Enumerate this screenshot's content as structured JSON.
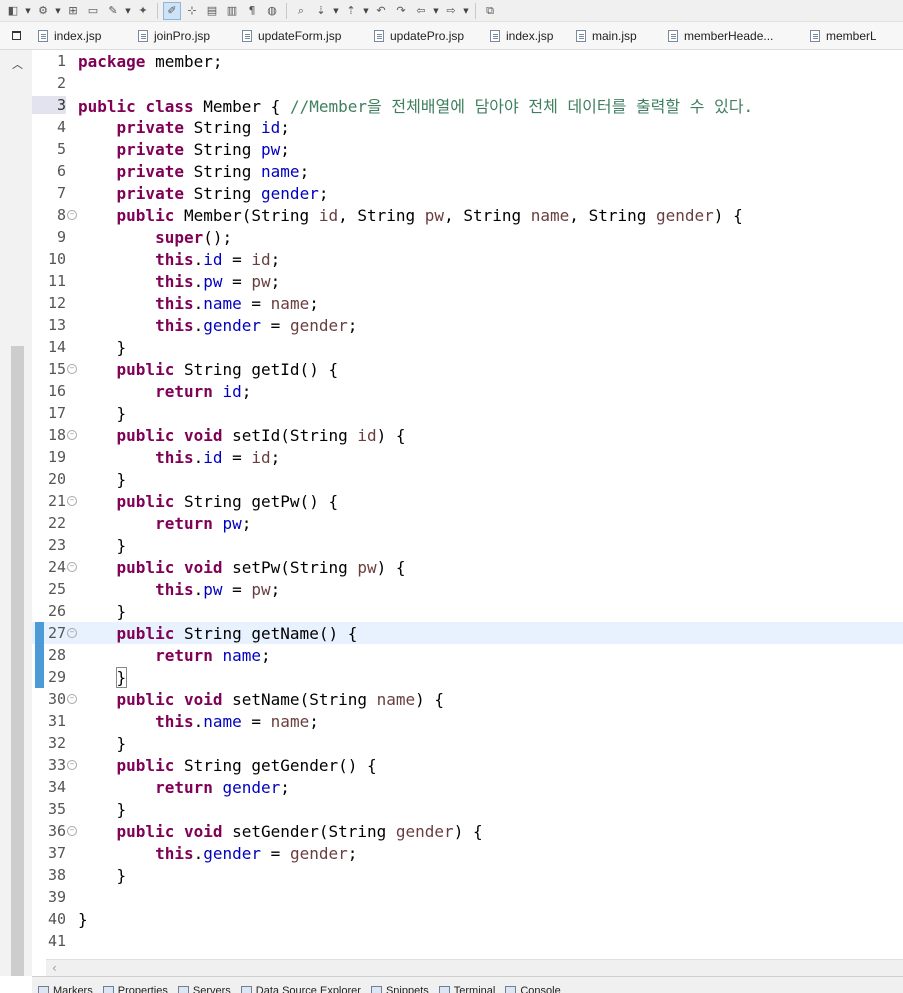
{
  "toolbar": {
    "buttons": [
      {
        "name": "new-wizard-icon",
        "glyph": "◧",
        "dropdown": true
      },
      {
        "name": "run-icon",
        "glyph": "⚙",
        "dropdown": true
      },
      {
        "name": "open-type-icon",
        "glyph": "⊞",
        "dropdown": false
      },
      {
        "name": "open-folder-icon",
        "glyph": "▭",
        "dropdown": false
      },
      {
        "name": "pen-icon",
        "glyph": "✎",
        "dropdown": true
      },
      {
        "name": "hint-icon",
        "glyph": "✦",
        "dropdown": false
      },
      {
        "name": "mark-occurrences-icon",
        "glyph": "✐",
        "dropdown": false,
        "active": true
      },
      {
        "name": "block-select-icon",
        "glyph": "⊹",
        "dropdown": false
      },
      {
        "name": "edit-icon",
        "glyph": "▤",
        "dropdown": false
      },
      {
        "name": "document-icon",
        "glyph": "▥",
        "dropdown": false
      },
      {
        "name": "pilcrow-icon",
        "glyph": "¶",
        "dropdown": false
      },
      {
        "name": "globe-icon",
        "glyph": "◍",
        "dropdown": false
      },
      {
        "name": "search-icon",
        "glyph": "⌕",
        "dropdown": false
      },
      {
        "name": "next-annotation-icon",
        "glyph": "⇣",
        "dropdown": true
      },
      {
        "name": "prev-annotation-icon",
        "glyph": "⇡",
        "dropdown": true
      },
      {
        "name": "last-edit-icon",
        "glyph": "↶",
        "dropdown": false
      },
      {
        "name": "forward-edit-icon",
        "glyph": "↷",
        "dropdown": false
      },
      {
        "name": "back-icon",
        "glyph": "⇦",
        "dropdown": true
      },
      {
        "name": "forward-icon",
        "glyph": "⇨",
        "dropdown": true
      },
      {
        "name": "pin-editor-icon",
        "glyph": "⧉",
        "dropdown": false
      }
    ]
  },
  "tabs": [
    {
      "label": "index.jsp",
      "width": 100
    },
    {
      "label": "joinPro.jsp",
      "width": 104
    },
    {
      "label": "updateForm.jsp",
      "width": 132
    },
    {
      "label": "updatePro.jsp",
      "width": 116
    },
    {
      "label": "index.jsp",
      "width": 86
    },
    {
      "label": "main.jsp",
      "width": 92
    },
    {
      "label": "memberHeade...",
      "width": 142
    },
    {
      "label": "memberLi",
      "width": 72
    }
  ],
  "editor": {
    "current_line": 27,
    "changed_lines": [
      27,
      28,
      29
    ],
    "highlighted_line_number": 3,
    "lines": [
      {
        "n": 1,
        "fold": false,
        "tokens": [
          [
            "kw",
            "package"
          ],
          [
            "t",
            " member;"
          ]
        ]
      },
      {
        "n": 2,
        "fold": false,
        "tokens": []
      },
      {
        "n": 3,
        "fold": false,
        "tokens": [
          [
            "kw",
            "public"
          ],
          [
            "t",
            " "
          ],
          [
            "kw",
            "class"
          ],
          [
            "t",
            " Member { "
          ],
          [
            "cmt",
            "//Member을 전체배열에 담아야 전체 데이터를 출력할 수 있다."
          ]
        ]
      },
      {
        "n": 4,
        "fold": false,
        "tokens": [
          [
            "t",
            "    "
          ],
          [
            "kw",
            "private"
          ],
          [
            "t",
            " String "
          ],
          [
            "fld",
            "id"
          ],
          [
            "t",
            ";"
          ]
        ]
      },
      {
        "n": 5,
        "fold": false,
        "tokens": [
          [
            "t",
            "    "
          ],
          [
            "kw",
            "private"
          ],
          [
            "t",
            " String "
          ],
          [
            "fld",
            "pw"
          ],
          [
            "t",
            ";"
          ]
        ]
      },
      {
        "n": 6,
        "fold": false,
        "tokens": [
          [
            "t",
            "    "
          ],
          [
            "kw",
            "private"
          ],
          [
            "t",
            " String "
          ],
          [
            "fld",
            "name"
          ],
          [
            "t",
            ";"
          ]
        ]
      },
      {
        "n": 7,
        "fold": false,
        "tokens": [
          [
            "t",
            "    "
          ],
          [
            "kw",
            "private"
          ],
          [
            "t",
            " String "
          ],
          [
            "fld",
            "gender"
          ],
          [
            "t",
            ";"
          ]
        ]
      },
      {
        "n": 8,
        "fold": true,
        "tokens": [
          [
            "t",
            "    "
          ],
          [
            "kw",
            "public"
          ],
          [
            "t",
            " Member(String "
          ],
          [
            "prm",
            "id"
          ],
          [
            "t",
            ", String "
          ],
          [
            "prm",
            "pw"
          ],
          [
            "t",
            ", String "
          ],
          [
            "prm",
            "name"
          ],
          [
            "t",
            ", String "
          ],
          [
            "prm",
            "gender"
          ],
          [
            "t",
            ") {"
          ]
        ]
      },
      {
        "n": 9,
        "fold": false,
        "tokens": [
          [
            "t",
            "        "
          ],
          [
            "kw",
            "super"
          ],
          [
            "t",
            "();"
          ]
        ]
      },
      {
        "n": 10,
        "fold": false,
        "tokens": [
          [
            "t",
            "        "
          ],
          [
            "kw",
            "this"
          ],
          [
            "t",
            "."
          ],
          [
            "fld",
            "id"
          ],
          [
            "t",
            " = "
          ],
          [
            "prm",
            "id"
          ],
          [
            "t",
            ";"
          ]
        ]
      },
      {
        "n": 11,
        "fold": false,
        "tokens": [
          [
            "t",
            "        "
          ],
          [
            "kw",
            "this"
          ],
          [
            "t",
            "."
          ],
          [
            "fld",
            "pw"
          ],
          [
            "t",
            " = "
          ],
          [
            "prm",
            "pw"
          ],
          [
            "t",
            ";"
          ]
        ]
      },
      {
        "n": 12,
        "fold": false,
        "tokens": [
          [
            "t",
            "        "
          ],
          [
            "kw",
            "this"
          ],
          [
            "t",
            "."
          ],
          [
            "fld",
            "name"
          ],
          [
            "t",
            " = "
          ],
          [
            "prm",
            "name"
          ],
          [
            "t",
            ";"
          ]
        ]
      },
      {
        "n": 13,
        "fold": false,
        "tokens": [
          [
            "t",
            "        "
          ],
          [
            "kw",
            "this"
          ],
          [
            "t",
            "."
          ],
          [
            "fld",
            "gender"
          ],
          [
            "t",
            " = "
          ],
          [
            "prm",
            "gender"
          ],
          [
            "t",
            ";"
          ]
        ]
      },
      {
        "n": 14,
        "fold": false,
        "tokens": [
          [
            "t",
            "    }"
          ]
        ]
      },
      {
        "n": 15,
        "fold": true,
        "tokens": [
          [
            "t",
            "    "
          ],
          [
            "kw",
            "public"
          ],
          [
            "t",
            " String getId() {"
          ]
        ]
      },
      {
        "n": 16,
        "fold": false,
        "tokens": [
          [
            "t",
            "        "
          ],
          [
            "kw",
            "return"
          ],
          [
            "t",
            " "
          ],
          [
            "fld",
            "id"
          ],
          [
            "t",
            ";"
          ]
        ]
      },
      {
        "n": 17,
        "fold": false,
        "tokens": [
          [
            "t",
            "    }"
          ]
        ]
      },
      {
        "n": 18,
        "fold": true,
        "tokens": [
          [
            "t",
            "    "
          ],
          [
            "kw",
            "public"
          ],
          [
            "t",
            " "
          ],
          [
            "kw",
            "void"
          ],
          [
            "t",
            " setId(String "
          ],
          [
            "prm",
            "id"
          ],
          [
            "t",
            ") {"
          ]
        ]
      },
      {
        "n": 19,
        "fold": false,
        "tokens": [
          [
            "t",
            "        "
          ],
          [
            "kw",
            "this"
          ],
          [
            "t",
            "."
          ],
          [
            "fld",
            "id"
          ],
          [
            "t",
            " = "
          ],
          [
            "prm",
            "id"
          ],
          [
            "t",
            ";"
          ]
        ]
      },
      {
        "n": 20,
        "fold": false,
        "tokens": [
          [
            "t",
            "    }"
          ]
        ]
      },
      {
        "n": 21,
        "fold": true,
        "tokens": [
          [
            "t",
            "    "
          ],
          [
            "kw",
            "public"
          ],
          [
            "t",
            " String getPw() {"
          ]
        ]
      },
      {
        "n": 22,
        "fold": false,
        "tokens": [
          [
            "t",
            "        "
          ],
          [
            "kw",
            "return"
          ],
          [
            "t",
            " "
          ],
          [
            "fld",
            "pw"
          ],
          [
            "t",
            ";"
          ]
        ]
      },
      {
        "n": 23,
        "fold": false,
        "tokens": [
          [
            "t",
            "    }"
          ]
        ]
      },
      {
        "n": 24,
        "fold": true,
        "tokens": [
          [
            "t",
            "    "
          ],
          [
            "kw",
            "public"
          ],
          [
            "t",
            " "
          ],
          [
            "kw",
            "void"
          ],
          [
            "t",
            " setPw(String "
          ],
          [
            "prm",
            "pw"
          ],
          [
            "t",
            ") {"
          ]
        ]
      },
      {
        "n": 25,
        "fold": false,
        "tokens": [
          [
            "t",
            "        "
          ],
          [
            "kw",
            "this"
          ],
          [
            "t",
            "."
          ],
          [
            "fld",
            "pw"
          ],
          [
            "t",
            " = "
          ],
          [
            "prm",
            "pw"
          ],
          [
            "t",
            ";"
          ]
        ]
      },
      {
        "n": 26,
        "fold": false,
        "tokens": [
          [
            "t",
            "    }"
          ]
        ]
      },
      {
        "n": 27,
        "fold": true,
        "tokens": [
          [
            "t",
            "    "
          ],
          [
            "kw",
            "public"
          ],
          [
            "t",
            " String getName() {"
          ]
        ]
      },
      {
        "n": 28,
        "fold": false,
        "tokens": [
          [
            "t",
            "        "
          ],
          [
            "kw",
            "return"
          ],
          [
            "t",
            " "
          ],
          [
            "fld",
            "name"
          ],
          [
            "t",
            ";"
          ]
        ]
      },
      {
        "n": 29,
        "fold": false,
        "tokens": [
          [
            "t",
            "    "
          ],
          [
            "bracket",
            "}"
          ]
        ]
      },
      {
        "n": 30,
        "fold": true,
        "tokens": [
          [
            "t",
            "    "
          ],
          [
            "kw",
            "public"
          ],
          [
            "t",
            " "
          ],
          [
            "kw",
            "void"
          ],
          [
            "t",
            " setName(String "
          ],
          [
            "prm",
            "name"
          ],
          [
            "t",
            ") {"
          ]
        ]
      },
      {
        "n": 31,
        "fold": false,
        "tokens": [
          [
            "t",
            "        "
          ],
          [
            "kw",
            "this"
          ],
          [
            "t",
            "."
          ],
          [
            "fld",
            "name"
          ],
          [
            "t",
            " = "
          ],
          [
            "prm",
            "name"
          ],
          [
            "t",
            ";"
          ]
        ]
      },
      {
        "n": 32,
        "fold": false,
        "tokens": [
          [
            "t",
            "    }"
          ]
        ]
      },
      {
        "n": 33,
        "fold": true,
        "tokens": [
          [
            "t",
            "    "
          ],
          [
            "kw",
            "public"
          ],
          [
            "t",
            " String getGender() {"
          ]
        ]
      },
      {
        "n": 34,
        "fold": false,
        "tokens": [
          [
            "t",
            "        "
          ],
          [
            "kw",
            "return"
          ],
          [
            "t",
            " "
          ],
          [
            "fld",
            "gender"
          ],
          [
            "t",
            ";"
          ]
        ]
      },
      {
        "n": 35,
        "fold": false,
        "tokens": [
          [
            "t",
            "    }"
          ]
        ]
      },
      {
        "n": 36,
        "fold": true,
        "tokens": [
          [
            "t",
            "    "
          ],
          [
            "kw",
            "public"
          ],
          [
            "t",
            " "
          ],
          [
            "kw",
            "void"
          ],
          [
            "t",
            " setGender(String "
          ],
          [
            "prm",
            "gender"
          ],
          [
            "t",
            ") {"
          ]
        ]
      },
      {
        "n": 37,
        "fold": false,
        "tokens": [
          [
            "t",
            "        "
          ],
          [
            "kw",
            "this"
          ],
          [
            "t",
            "."
          ],
          [
            "fld",
            "gender"
          ],
          [
            "t",
            " = "
          ],
          [
            "prm",
            "gender"
          ],
          [
            "t",
            ";"
          ]
        ]
      },
      {
        "n": 38,
        "fold": false,
        "tokens": [
          [
            "t",
            "    }"
          ]
        ]
      },
      {
        "n": 39,
        "fold": false,
        "tokens": []
      },
      {
        "n": 40,
        "fold": false,
        "tokens": [
          [
            "t",
            "}"
          ]
        ]
      },
      {
        "n": 41,
        "fold": false,
        "tokens": []
      }
    ]
  },
  "bottom_tabs": [
    {
      "label": "Markers",
      "icon": "markers-icon"
    },
    {
      "label": "Properties",
      "icon": "properties-icon"
    },
    {
      "label": "Servers",
      "icon": "servers-icon"
    },
    {
      "label": "Data Source Explorer",
      "icon": "data-source-icon"
    },
    {
      "label": "Snippets",
      "icon": "snippets-icon"
    },
    {
      "label": "Terminal",
      "icon": "terminal-icon"
    },
    {
      "label": "Console",
      "icon": "console-icon"
    }
  ]
}
